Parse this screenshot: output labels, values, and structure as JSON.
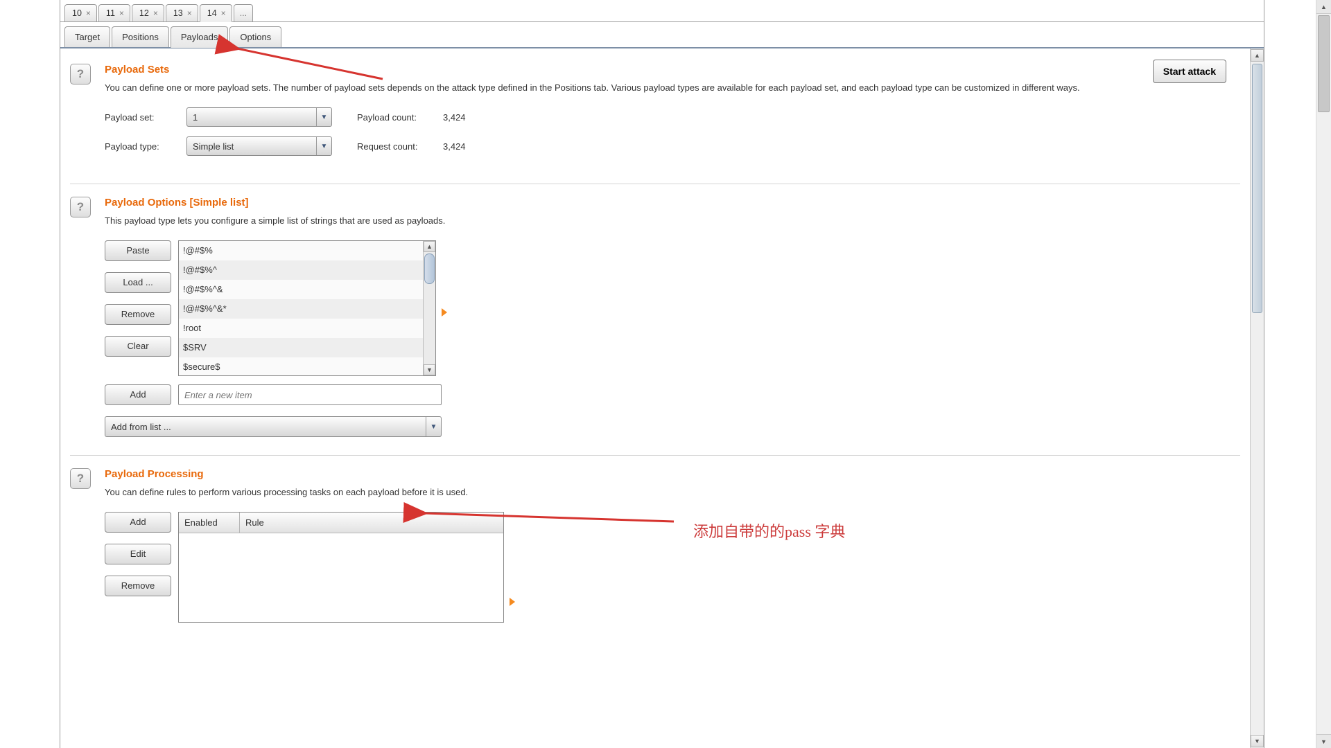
{
  "num_tabs": [
    "10",
    "11",
    "12",
    "13",
    "14"
  ],
  "num_tabs_active": "14",
  "num_tab_dots": "...",
  "section_tabs": [
    "Target",
    "Positions",
    "Payloads",
    "Options"
  ],
  "section_tab_active": "Payloads",
  "start_attack": "Start attack",
  "payload_sets": {
    "title": "Payload Sets",
    "desc": "You can define one or more payload sets. The number of payload sets depends on the attack type defined in the Positions tab. Various payload types are available for each payload set, and each payload type can be customized in different ways.",
    "set_label": "Payload set:",
    "set_value": "1",
    "type_label": "Payload type:",
    "type_value": "Simple list",
    "payload_count_label": "Payload count:",
    "payload_count_value": "3,424",
    "request_count_label": "Request count:",
    "request_count_value": "3,424"
  },
  "payload_options": {
    "title": "Payload Options [Simple list]",
    "desc": "This payload type lets you configure a simple list of strings that are used as payloads.",
    "buttons": {
      "paste": "Paste",
      "load": "Load ...",
      "remove": "Remove",
      "clear": "Clear",
      "add": "Add"
    },
    "list": [
      "!@#$%",
      "!@#$%^",
      "!@#$%^&",
      "!@#$%^&*",
      "!root",
      "$SRV",
      "$secure$"
    ],
    "add_placeholder": "Enter a new item",
    "add_from_list": "Add from list ..."
  },
  "payload_processing": {
    "title": "Payload Processing",
    "desc": "You can define rules to perform various processing tasks on each payload before it is used.",
    "buttons": {
      "add": "Add",
      "edit": "Edit",
      "remove": "Remove"
    },
    "cols": {
      "enabled": "Enabled",
      "rule": "Rule"
    }
  },
  "annotation_text": "添加自带的的pass 字典",
  "help_icon": "?"
}
